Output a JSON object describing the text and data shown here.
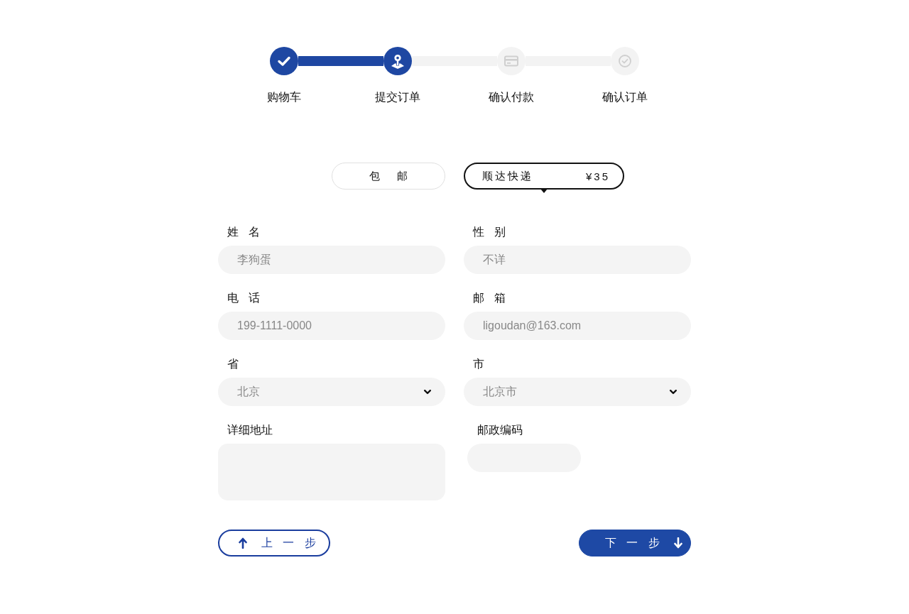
{
  "steps": [
    {
      "label": "购物车",
      "active": true
    },
    {
      "label": "提交订单",
      "active": true
    },
    {
      "label": "确认付款",
      "active": false
    },
    {
      "label": "确认订单",
      "active": false
    }
  ],
  "shipping_options": [
    {
      "label": "包 邮",
      "selected": false
    },
    {
      "label": "顺达快递",
      "price": "¥35",
      "selected": true
    }
  ],
  "form": {
    "fields": [
      {
        "kind": "text",
        "label": "姓 名",
        "placeholder": "李狗蛋"
      },
      {
        "kind": "text",
        "label": "性 别",
        "placeholder": "不详"
      },
      {
        "kind": "text",
        "label": "电 话",
        "placeholder": "199-1111-0000"
      },
      {
        "kind": "text",
        "label": "邮 箱",
        "placeholder": "ligoudan@163.com"
      },
      {
        "kind": "select",
        "label": "省",
        "value": "北京"
      },
      {
        "kind": "select",
        "label": "市",
        "value": "北京市"
      },
      {
        "kind": "textarea",
        "label": "详细地址"
      },
      {
        "kind": "short",
        "label": "邮政编码"
      }
    ]
  },
  "buttons": [
    {
      "kind": "prev",
      "label": "上 一 步"
    },
    {
      "kind": "next",
      "label": "下 一 步"
    }
  ]
}
